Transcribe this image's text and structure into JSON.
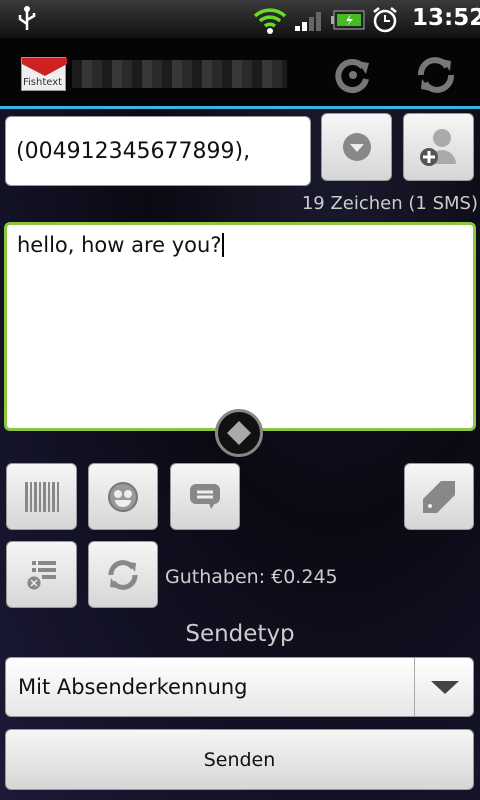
{
  "status_bar": {
    "time": "13:52",
    "icons": [
      "usb-icon",
      "wifi-icon",
      "signal-icon",
      "battery-charging-icon",
      "alarm-icon"
    ]
  },
  "app_bar": {
    "logo_text": "Fishtext",
    "icons": [
      "refresh-icon",
      "sync-icon"
    ]
  },
  "recipient": {
    "value": "(004912345677899),"
  },
  "char_count": "19 Zeichen (1 SMS)",
  "message": {
    "value": "hello, how are you?"
  },
  "balance": "Guthaben: €0.245",
  "send_type": {
    "label": "Sendetyp",
    "selected": "Mit Absenderkennung"
  },
  "send_button": "Senden",
  "colors": {
    "accent": "#35b5e5",
    "textarea_border": "#8cc63f"
  }
}
